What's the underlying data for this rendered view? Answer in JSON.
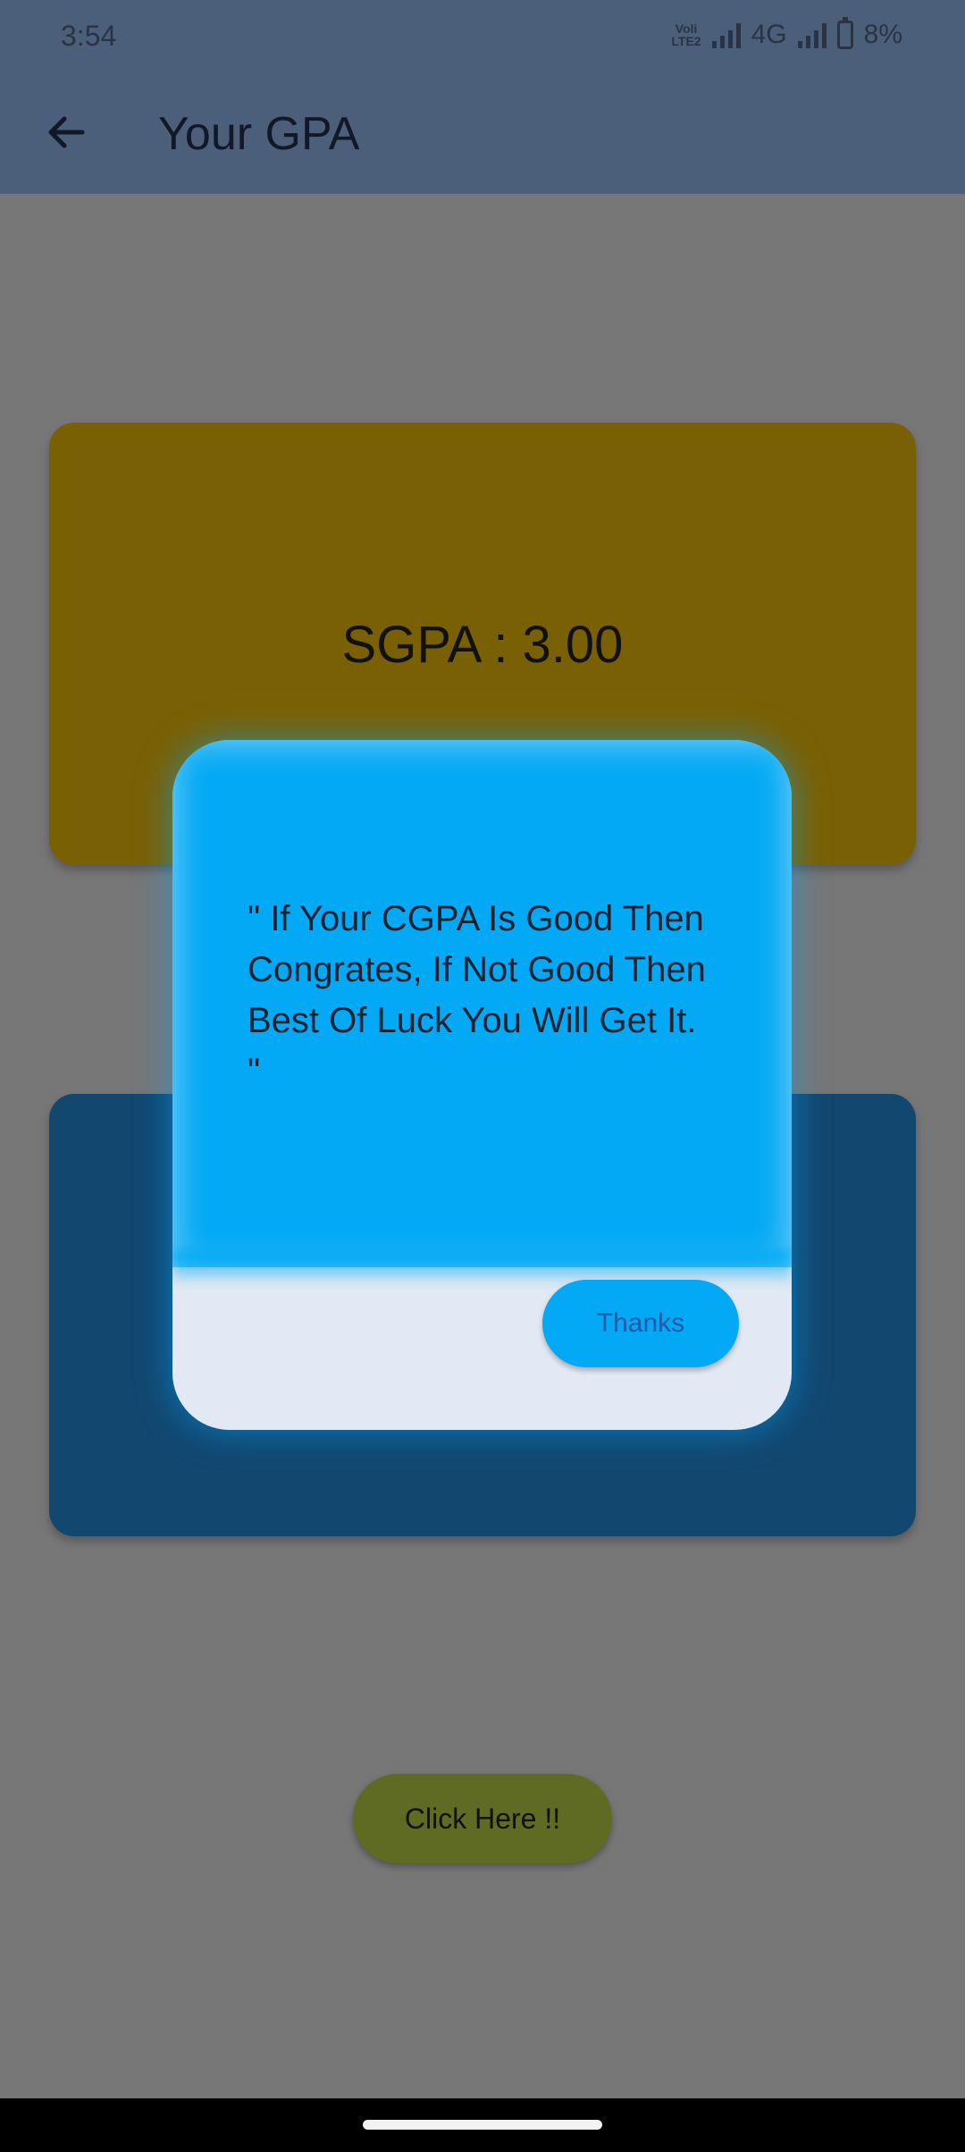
{
  "status_bar": {
    "time": "3:54",
    "volte_label": "Voli LTE2",
    "network_label": "4G",
    "battery_percent": "8%"
  },
  "app_bar": {
    "title": "Your GPA",
    "back_icon": "arrow-left-icon"
  },
  "sgpa_card": {
    "text": "SGPA : 3.00",
    "color": "#7a6004"
  },
  "cgpa_card": {
    "color": "#124770"
  },
  "click_button": {
    "label": "Click Here !!"
  },
  "dialog": {
    "message": "\" If Your CGPA Is Good Then Congrates, If Not Good Then Best Of Luck You Will Get It. \"",
    "button_label": "Thanks",
    "accent": "#03a9f4"
  }
}
